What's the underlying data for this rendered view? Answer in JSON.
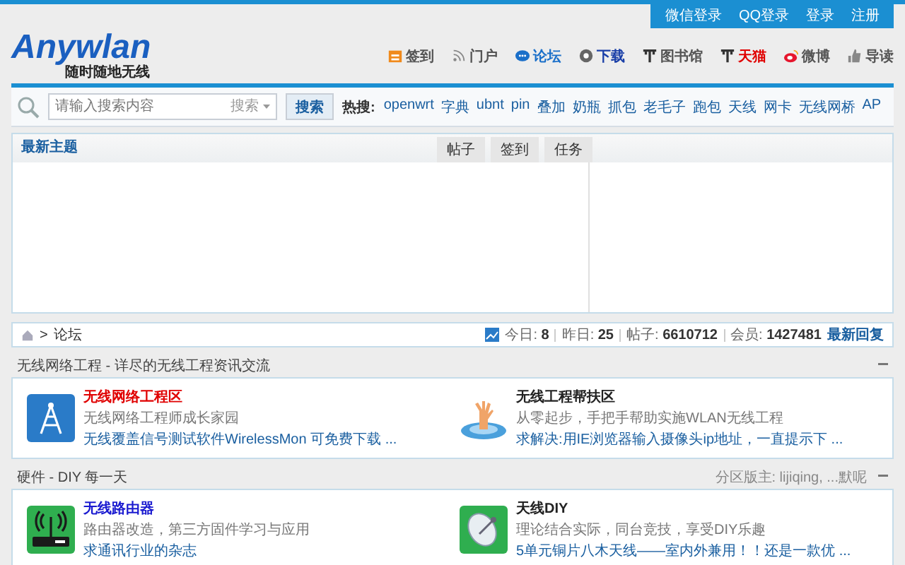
{
  "top_links": [
    "微信登录",
    "QQ登录",
    "登录",
    "注册"
  ],
  "logo": {
    "name": "Anywlan",
    "slogan": "随时随地无线"
  },
  "nav": [
    {
      "kind": "checkin",
      "label": "签到",
      "color": "#555555"
    },
    {
      "kind": "rss",
      "label": "门户",
      "color": "#555555"
    },
    {
      "kind": "chat",
      "label": "论坛",
      "color": "#1a6fc9"
    },
    {
      "kind": "disc",
      "label": "下载",
      "color": "#1a3fa8"
    },
    {
      "kind": "antenna",
      "label": "图书馆",
      "color": "#555555"
    },
    {
      "kind": "antenna",
      "label": "天猫",
      "color": "#e00000"
    },
    {
      "kind": "weibo",
      "label": "微博",
      "color": "#555555"
    },
    {
      "kind": "thumb",
      "label": "导读",
      "color": "#555555"
    }
  ],
  "search": {
    "placeholder": "请输入搜索内容",
    "scope": "搜索",
    "button": "搜索",
    "hot_label": "热搜:",
    "hot": [
      "openwrt",
      "字典",
      "ubnt",
      "pin",
      "叠加",
      "奶瓶",
      "抓包",
      "老毛子",
      "跑包",
      "天线",
      "网卡",
      "无线网桥",
      "AP"
    ]
  },
  "panel": {
    "title": "最新主题",
    "tabs": [
      "帖子",
      "签到",
      "任务"
    ]
  },
  "breadcrumb": {
    "separator": ">",
    "current": "论坛"
  },
  "stats": [
    "今日: **8**",
    "昨日: **25**",
    "帖子: **6610712**",
    "会员: **1427481**"
  ],
  "latest_link": "最新回复",
  "sections": [
    {
      "title": "无线网络工程 - 详尽的无线工程资讯交流",
      "forums": [
        {
          "kind": "tower",
          "name": "无线网络工程区",
          "color": "#e00000",
          "desc": "无线网络工程师成长家园",
          "last": "无线覆盖信号测试软件WirelessMon 可免费下载 ..."
        },
        {
          "kind": "hand",
          "name": "无线工程帮扶区",
          "color": "#222222",
          "desc": "从零起步，手把手帮助实施WLAN无线工程",
          "last": "求解决:用IE浏览器输入摄像头ip地址，一直提示下 ..."
        }
      ]
    },
    {
      "title": "硬件 - DIY 每一天",
      "moderators": "分区版主: lijiqing, ...默呢",
      "forums": [
        {
          "kind": "router",
          "name": "无线路由器",
          "color": "#1a1ad0",
          "desc": "路由器改造，第三方固件学习与应用",
          "last": "求通讯行业的杂志"
        },
        {
          "kind": "dish",
          "name": "天线DIY",
          "color": "#222222",
          "desc": "理论结合实际，同台竞技，享受DIY乐趣",
          "last": "5单元铜片八木天线——室内外兼用！！还是一款优 ..."
        }
      ]
    }
  ]
}
